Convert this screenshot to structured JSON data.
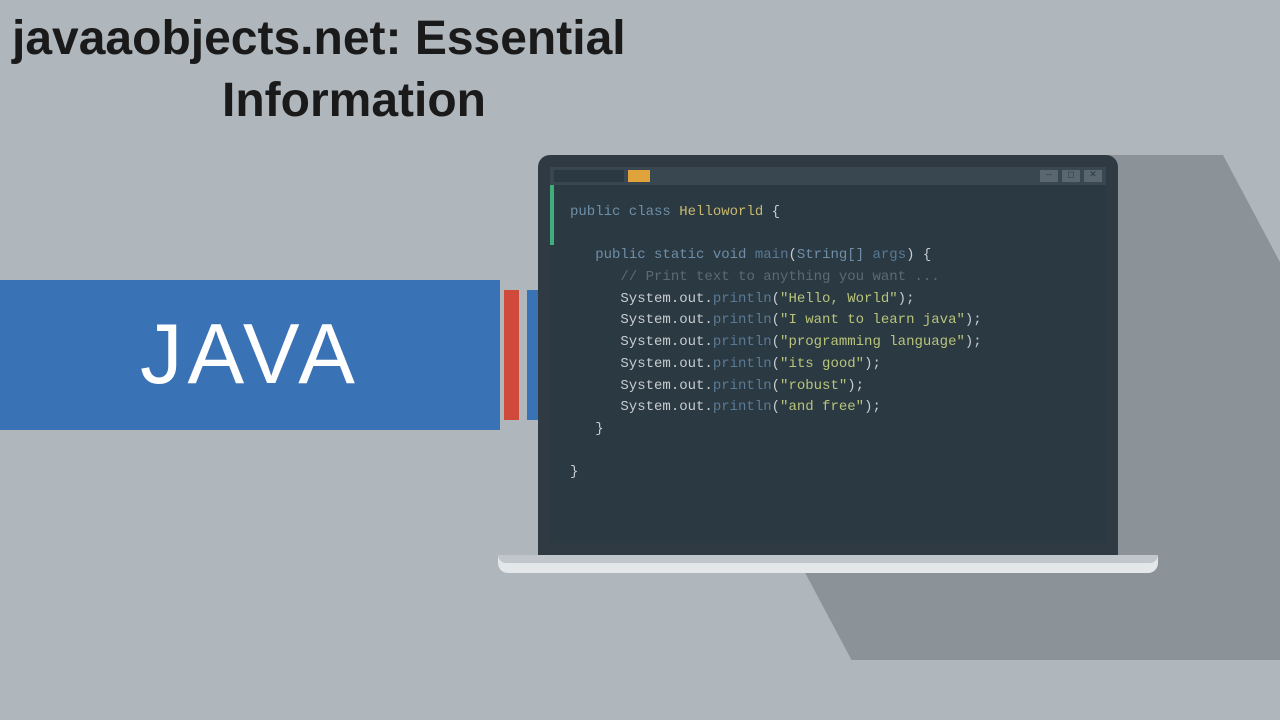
{
  "title_line1": "javaaobjects.net: Essential",
  "title_line2": "Information",
  "banner_text": "JAVA",
  "code": {
    "class_decl_kw": "public class",
    "class_name": "Helloworld",
    "method_decl_kw": "public static void",
    "method_name": "main",
    "params_type": "String[]",
    "params_name": "args",
    "comment": "// Print text to anything you want ...",
    "call_prefix": "System.out.",
    "call_method": "println",
    "lines": [
      "\"Hello, World\"",
      "\"I want to learn java\"",
      "\"programming language\"",
      "\"its good\"",
      "\"robust\"",
      "\"and free\""
    ]
  },
  "window_controls": [
    "—",
    "◻",
    "✕"
  ],
  "stripe_pattern_left": [
    "red",
    "blue"
  ],
  "stripe_pattern_right": [
    "blue",
    "red",
    "blue",
    "red",
    "blue",
    "red",
    "blue"
  ]
}
